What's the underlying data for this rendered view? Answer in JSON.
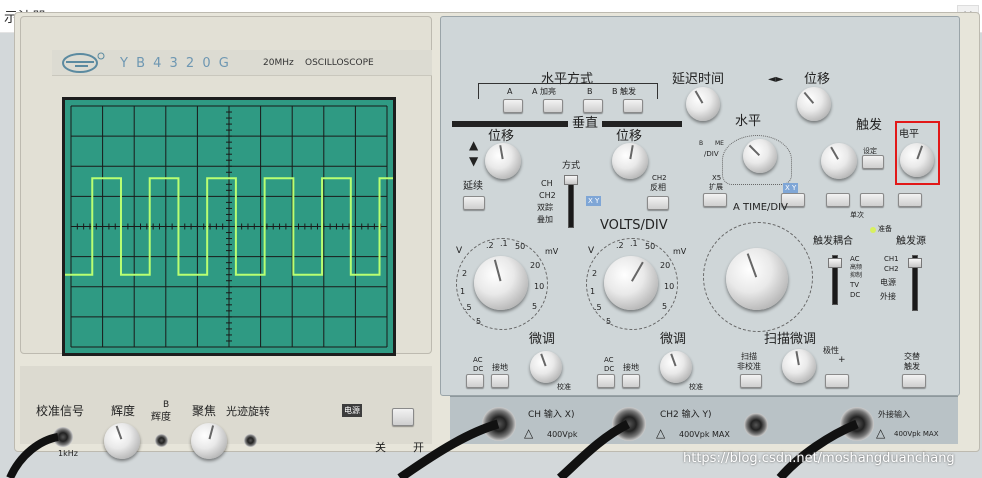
{
  "window": {
    "title": "示波器",
    "close_glyph": "×"
  },
  "brand": {
    "model": "Y B 4 3 2 0 G",
    "spec": "20MHz",
    "type": "OSCILLOSCOPE"
  },
  "left_bottom": {
    "cal_signal": "校准信号",
    "cal_freq": "1kHz",
    "intensity": "辉度",
    "b_intensity_top": "B",
    "b_intensity": "辉度",
    "focus": "聚焦",
    "trace_rotation": "光迹旋转",
    "power_badge": "电源",
    "power_off": "关",
    "power_on": "开"
  },
  "horizontal_mode": {
    "title": "水平方式",
    "buttons": [
      "A",
      "A 加亮",
      "B",
      "B 触发"
    ]
  },
  "delay_time": "延迟时间",
  "position_arrows": "◄►",
  "position": "位移",
  "horizontal": "水平",
  "vertical": "垂直",
  "trigger": "触发",
  "level": "电平",
  "mode": "方式",
  "setup_btn": "设定",
  "mode_labels": [
    "CH",
    "CH2",
    "双踪",
    "叠加"
  ],
  "mode_badge": "X Y",
  "ch2_invert": [
    "CH2",
    "反相"
  ],
  "chop": "延续",
  "volts_div": "VOLTS/DIV",
  "ch1_scale": {
    "tl": "V",
    "tr": "mV",
    "ticks": [
      ".2",
      ".1",
      "50",
      "20",
      "10",
      "5",
      "2",
      "1",
      ".5",
      "5"
    ]
  },
  "ch2_scale": {
    "tl": "V",
    "tr": "mV",
    "ticks": [
      ".2",
      ".1",
      "50",
      "20",
      "10",
      "5",
      "2",
      "1",
      ".5",
      "5"
    ]
  },
  "time_div": "A TIME/DIV",
  "x5_mag": [
    "X5",
    "扩展"
  ],
  "b_mag_labels": [
    "B",
    "ME",
    "/DIV"
  ],
  "fine1": "微调",
  "fine2": "微调",
  "calib_small": "校准",
  "sweep_fine": "扫描微调",
  "sweep_labels": [
    "扫描",
    "非校准"
  ],
  "polarity": [
    "极性",
    "+"
  ],
  "alt_trigger": [
    "交替",
    "触发"
  ],
  "ac": "AC",
  "dc": "DC",
  "gnd": "接地",
  "single": "单次",
  "ready": "准备",
  "trig_coupling": "触发耦合",
  "trig_coupling_opts": [
    "AC",
    "高频",
    "抑制",
    "TV",
    "DC"
  ],
  "trig_source": "触发源",
  "trig_source_opts": [
    "CH1",
    "CH2",
    "电源",
    "外接"
  ],
  "ch1_input": "CH  输入  X)",
  "ch2_input": "CH2 输入  Y)",
  "ext_input": "外接输入",
  "warn_ch1": "400Vpk",
  "warn_ch2": "400Vpk  MAX",
  "warn_ext": "400Vpk MAX",
  "watermark": "https://blog.csdn.net/moshangduanchang",
  "screen_grid": {
    "hdiv": 10,
    "vdiv": 8
  },
  "waveform": {
    "type": "square",
    "periods_shown": 5.5,
    "high_div": 1.6,
    "low_div": -1.6,
    "color": "#b9ff72"
  }
}
